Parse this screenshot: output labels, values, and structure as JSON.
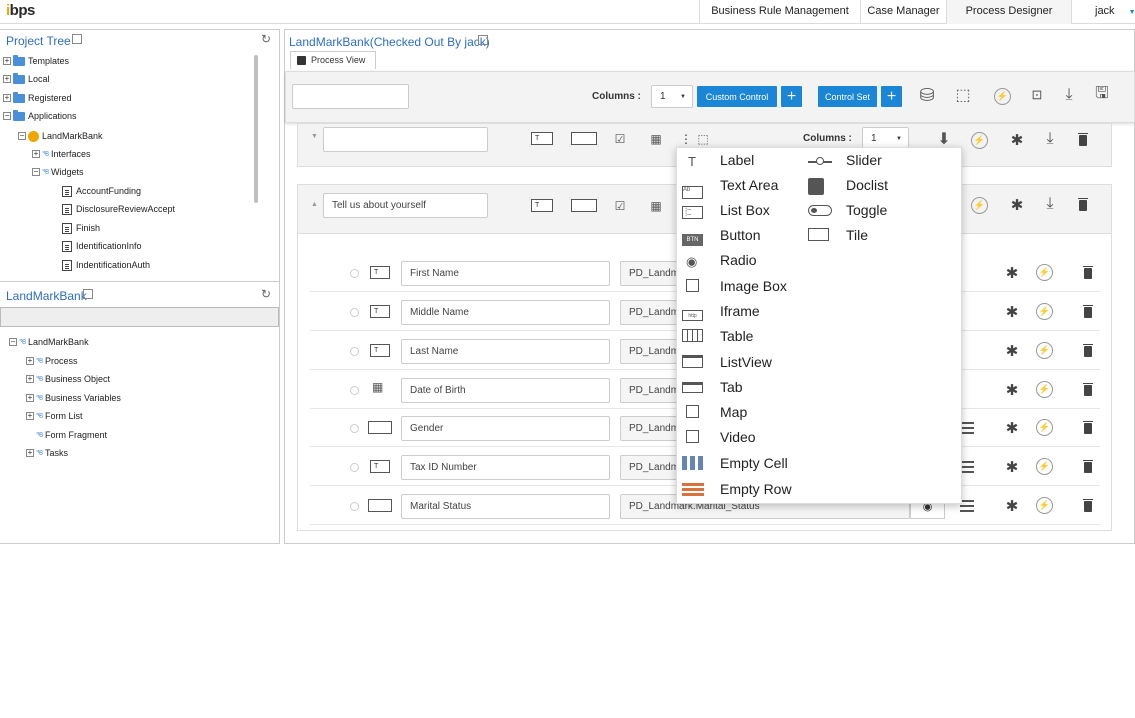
{
  "topbar": {
    "logo": "bps",
    "nav": [
      "Business Rule Management",
      "Case Manager",
      "Process Designer"
    ],
    "user": "jack"
  },
  "project_tree": {
    "title": "Project Tree",
    "items": [
      "Templates",
      "Local",
      "Registered",
      "Applications",
      "LandMarkBank",
      "Interfaces",
      "Widgets",
      "AccountFunding",
      "DisclosureReviewAccept",
      "Finish",
      "IdentificationInfo",
      "IndentificationAuth"
    ]
  },
  "project_panel": {
    "title": "LandMarkBank",
    "items": [
      "LandMarkBank",
      "Process",
      "Business Object",
      "Business Variables",
      "Form List",
      "Form Fragment",
      "Tasks"
    ]
  },
  "main": {
    "title": "LandMarkBank(Checked Out By jack)",
    "tab": "Process View",
    "toolbar": {
      "columns_label": "Columns :",
      "columns_value": "1",
      "custom_control": "Custom Control",
      "control_set": "Control Set"
    },
    "section1": {
      "columns_label": "Columns :",
      "columns_value": "1"
    },
    "section2": {
      "title": "Tell us about yourself"
    },
    "fields": [
      {
        "label": "First Name",
        "binding": "PD_Landm"
      },
      {
        "label": "Middle Name",
        "binding": "PD_Landm"
      },
      {
        "label": "Last Name",
        "binding": "PD_Landm"
      },
      {
        "label": "Date of Birth",
        "binding": "PD_Landm"
      },
      {
        "label": "Gender",
        "binding": "PD_Landm"
      },
      {
        "label": "Tax ID Number",
        "binding": "PD_Landm"
      },
      {
        "label": "Marital Status",
        "binding": "PD_Landmark.Marital_Status"
      }
    ]
  },
  "dropdown": {
    "col1": [
      "Label",
      "Text Area",
      "List Box",
      "Button",
      "Radio",
      "Image Box",
      "Iframe",
      "Table",
      "ListView",
      "Tab",
      "Map",
      "Video",
      "Empty Cell",
      "Empty Row"
    ],
    "col2": [
      "Slider",
      "Doclist",
      "Toggle",
      "Tile"
    ]
  },
  "icons": {
    "field_icon_text": "T",
    "button_icon_text": "BTN",
    "iframe_icon_text": "http"
  },
  "colors": {
    "accent": "#1b86d6",
    "link": "#2d6ec4",
    "logo": "#f0a500"
  }
}
